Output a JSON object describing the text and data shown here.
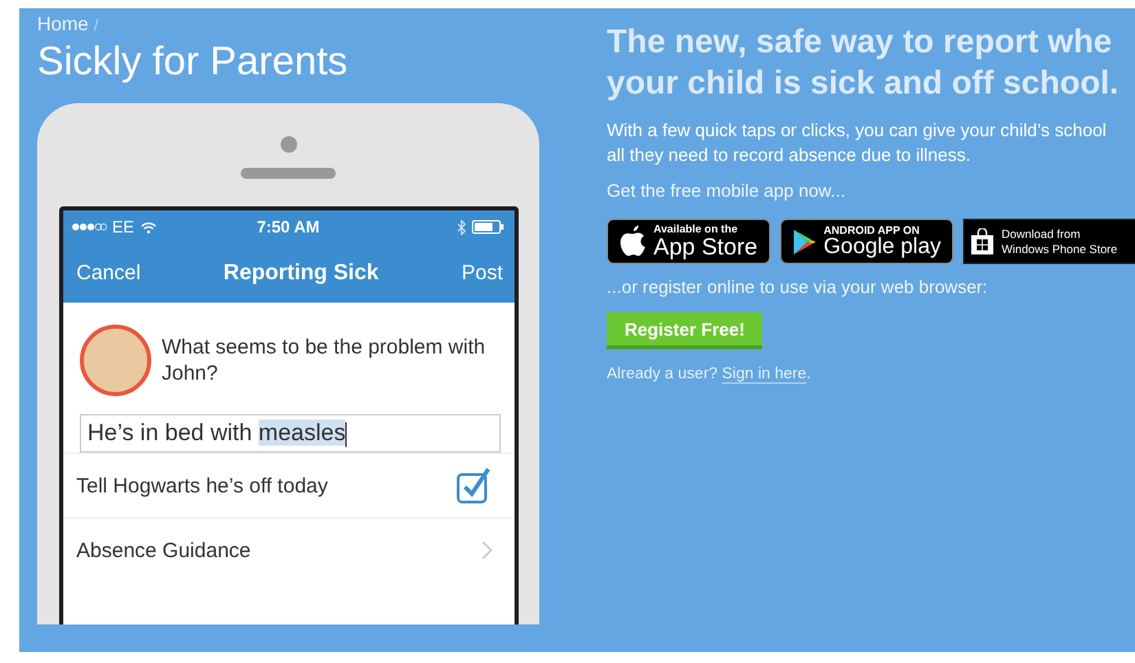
{
  "breadcrumb": {
    "items": [
      "Home"
    ],
    "separator": "/"
  },
  "page_title": "Sickly for Parents",
  "phone": {
    "status_bar": {
      "carrier": "EE",
      "time": "7:50 AM"
    },
    "nav": {
      "left": "Cancel",
      "title": "Reporting Sick",
      "right": "Post"
    },
    "question": "What seems to be the problem with John?",
    "answer": {
      "value": "He’s in bed with ",
      "selected_text": "measles"
    },
    "rows": [
      {
        "kind": "checkbox",
        "label": "Tell Hogwarts he’s off today",
        "checked": true
      },
      {
        "kind": "link",
        "label": "Absence Guidance"
      }
    ]
  },
  "headline_lines": [
    "The new, safe way to report whe",
    "your child is sick and off school."
  ],
  "intro": "With a few quick taps or clicks, you can give your child’s school all they need to record absence due to illness.",
  "app_prompt": "Get the free mobile app now...",
  "store_badges": [
    {
      "kind": "apple",
      "small": "Available on the",
      "large": "App Store"
    },
    {
      "kind": "google",
      "small": "ANDROID APP ON",
      "large": "Google play"
    },
    {
      "kind": "windows",
      "small": "Download from",
      "large": "Windows Phone Store"
    }
  ],
  "register_prompt": "...or register online to use via your web browser:",
  "register_button": "Register Free!",
  "signin": {
    "text": "Already a user? ",
    "link": "Sign in here",
    "after": "."
  }
}
